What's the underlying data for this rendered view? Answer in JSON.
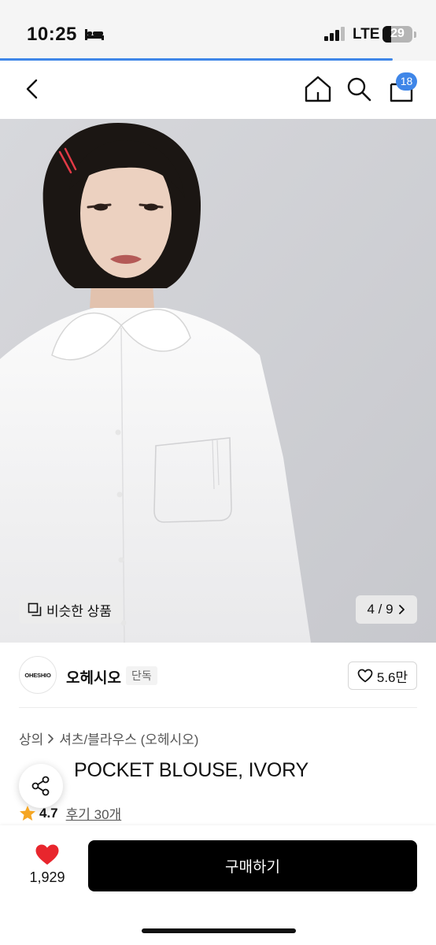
{
  "status_bar": {
    "time": "10:25",
    "network": "LTE",
    "battery": "29"
  },
  "page_load_progress": 0.9,
  "nav": {
    "cart_count": "18"
  },
  "product_image": {
    "similar_label": "비슷한 상품",
    "page_counter": "4 / 9"
  },
  "brand": {
    "logo_text": "OHESHIO",
    "name": "오헤시오",
    "badge": "단독",
    "likes": "5.6만"
  },
  "breadcrumb": {
    "category": "상의",
    "subcategory": "셔츠/블라우스 (오헤시오)"
  },
  "product": {
    "title": "POCKET BLOUSE, IVORY",
    "rating": "4.7",
    "reviews": "후기 30개"
  },
  "bottom_bar": {
    "like_count": "1,929",
    "buy_label": "구매하기"
  },
  "colors": {
    "accent": "#3f86e8",
    "like": "#e8262d",
    "star": "#f5a623",
    "buy_button": "#000000"
  },
  "icons": [
    "bed-icon",
    "signal-icon",
    "back-icon",
    "home-icon",
    "search-icon",
    "cart-icon",
    "copy-icon",
    "chevron-right-icon",
    "heart-outline-icon",
    "share-icon",
    "star-icon",
    "heart-filled-icon"
  ]
}
